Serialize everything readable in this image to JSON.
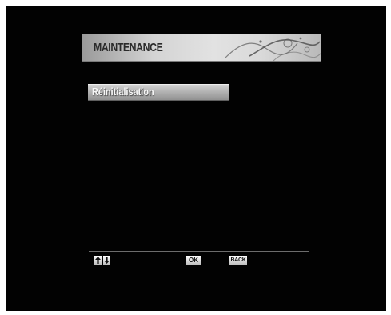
{
  "header": {
    "title": "MAINTENANCE"
  },
  "menu": {
    "items": [
      {
        "label": "Réinitialisation",
        "selected": true
      }
    ]
  },
  "footer": {
    "keys": [
      {
        "icon": "up-down-arrows-icon",
        "label": ""
      },
      {
        "icon": "ok-key-icon",
        "label": "OK"
      },
      {
        "icon": "back-key-icon",
        "label": "BACK"
      }
    ]
  },
  "colors": {
    "background": "#020202",
    "title_bar": "#d4d4d4",
    "selected_item": "#b3b3b3",
    "text_light": "#f7f7f7",
    "text_dark": "#2b2b2b"
  }
}
